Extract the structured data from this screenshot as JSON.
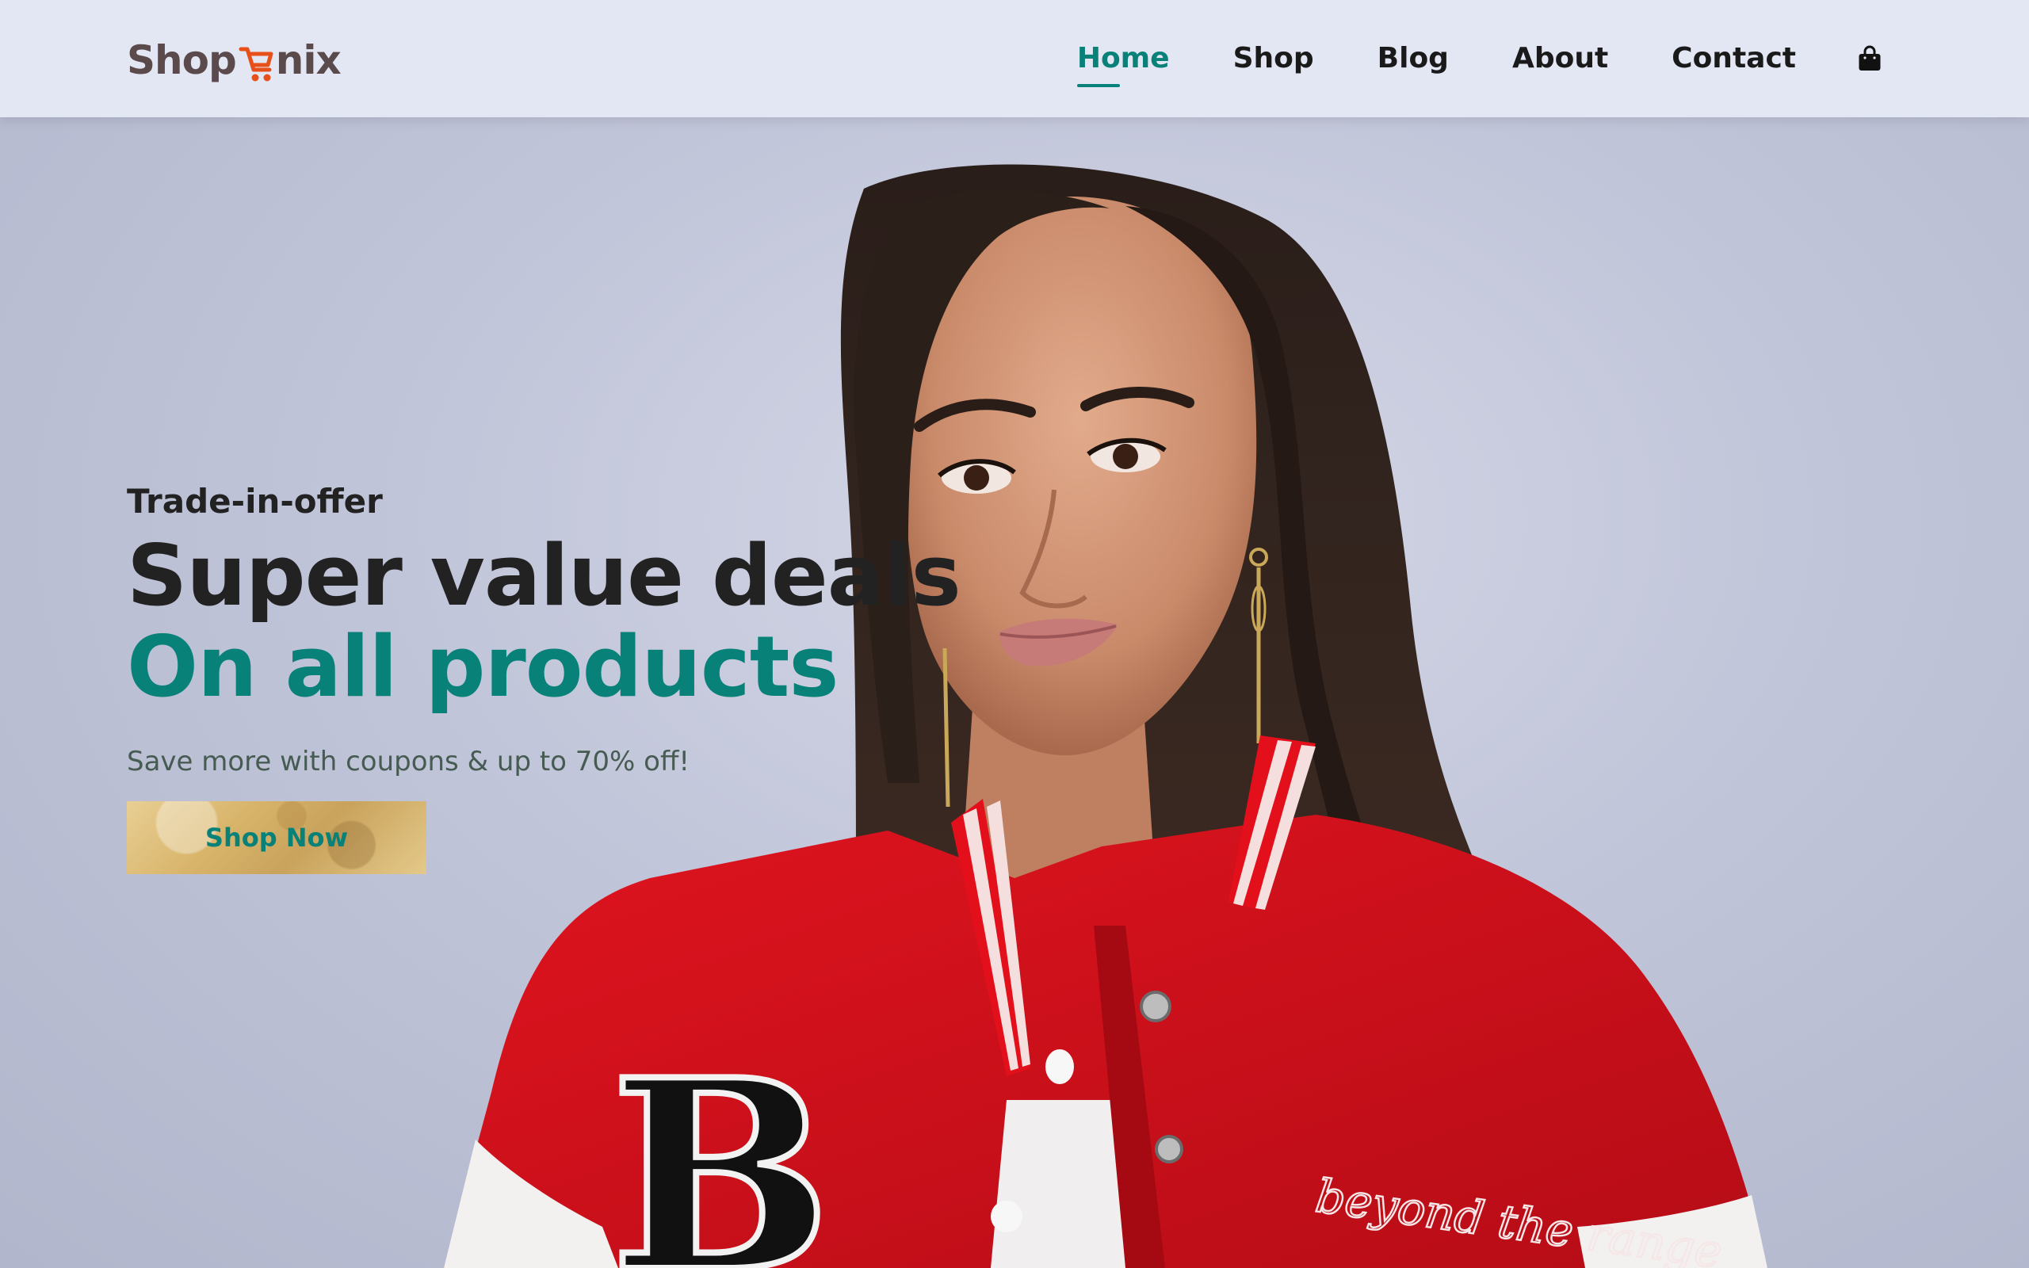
{
  "brand": {
    "logo_left": "Shop",
    "logo_right": "nix",
    "cart_color": "#e8501a"
  },
  "nav": {
    "items": [
      {
        "label": "Home",
        "active": true
      },
      {
        "label": "Shop"
      },
      {
        "label": "Blog"
      },
      {
        "label": "About"
      },
      {
        "label": "Contact"
      }
    ],
    "cart_icon": "shopping-bag-icon"
  },
  "hero": {
    "kicker": "Trade-in-offer",
    "headline": "Super value deals",
    "subheadline": "On all products",
    "description": "Save more with coupons & up to 70% off!",
    "cta_label": "Shop Now",
    "jacket_text": "beyond the range",
    "jacket_letter": "B"
  },
  "colors": {
    "accent": "#088178",
    "header_bg": "#e3e6f3",
    "text_dark": "#222222",
    "jacket_red": "#d4101c"
  }
}
